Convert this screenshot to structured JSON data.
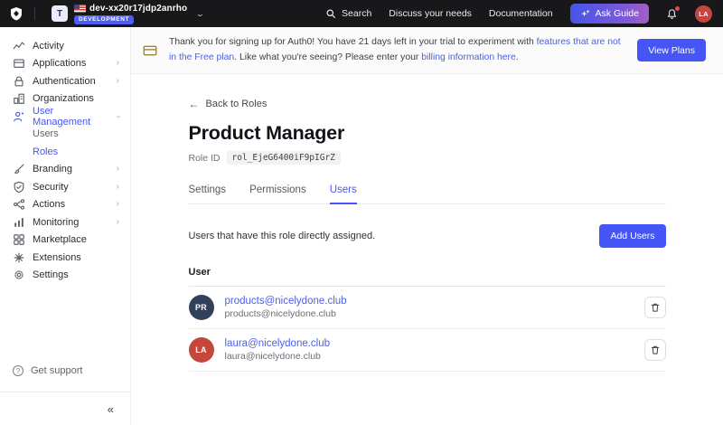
{
  "topbar": {
    "logo_icon": "auth0-shield-icon",
    "tenant": {
      "initial": "T",
      "flag_icon": "us-flag-icon",
      "name": "dev-xx20r17jdp2anrho",
      "env_badge": "DEVELOPMENT"
    },
    "search_label": "Search",
    "links": [
      "Discuss your needs",
      "Documentation"
    ],
    "ask_guide_label": "Ask Guide",
    "bell_icon": "bell-icon",
    "avatar_initials": "LA"
  },
  "banner": {
    "icon": "credit-card-icon",
    "text_before_link1": "Thank you for signing up for Auth0! You have 21 days left in your trial to experiment with ",
    "link1": "features that are not in the Free plan",
    "text_between": ". Like what you're seeing? Please enter your ",
    "link2": "billing information here",
    "text_after": ".",
    "view_plans_button": "View Plans"
  },
  "sidebar": {
    "items": [
      {
        "label": "Activity",
        "icon": "activity-icon",
        "chevron": "none"
      },
      {
        "label": "Applications",
        "icon": "applications-icon",
        "chevron": "right"
      },
      {
        "label": "Authentication",
        "icon": "authentication-icon",
        "chevron": "right"
      },
      {
        "label": "Organizations",
        "icon": "organizations-icon",
        "chevron": "none"
      },
      {
        "label": "User Management",
        "icon": "user-management-icon",
        "chevron": "down",
        "active": true,
        "children": [
          {
            "label": "Users",
            "active": false
          },
          {
            "label": "Roles",
            "active": true
          }
        ]
      },
      {
        "label": "Branding",
        "icon": "branding-icon",
        "chevron": "right"
      },
      {
        "label": "Security",
        "icon": "security-icon",
        "chevron": "right"
      },
      {
        "label": "Actions",
        "icon": "actions-icon",
        "chevron": "right"
      },
      {
        "label": "Monitoring",
        "icon": "monitoring-icon",
        "chevron": "right"
      },
      {
        "label": "Marketplace",
        "icon": "marketplace-icon",
        "chevron": "none"
      },
      {
        "label": "Extensions",
        "icon": "extensions-icon",
        "chevron": "none"
      },
      {
        "label": "Settings",
        "icon": "settings-icon",
        "chevron": "none"
      }
    ],
    "get_support": "Get support"
  },
  "main": {
    "back_link": "Back to Roles",
    "title": "Product Manager",
    "role_id_label": "Role ID",
    "role_id_value": "rol_EjeG6400iF9pIGrZ",
    "tabs": [
      {
        "label": "Settings",
        "active": false
      },
      {
        "label": "Permissions",
        "active": false
      },
      {
        "label": "Users",
        "active": true
      }
    ],
    "description": "Users that have this role directly assigned.",
    "add_users_button": "Add Users",
    "table": {
      "header": "User",
      "rows": [
        {
          "initials": "PR",
          "avatar_color": "#32405a",
          "email_link": "products@nicelydone.club",
          "email_sub": "products@nicelydone.club"
        },
        {
          "initials": "LA",
          "avatar_color": "#c4473a",
          "email_link": "laura@nicelydone.club",
          "email_sub": "laura@nicelydone.club"
        }
      ]
    }
  },
  "colors": {
    "topbar_bg": "#18181a",
    "accent_indigo": "#4655f5",
    "link_blue": "#4a5fe8",
    "env_badge_blue": "#4c5ef5",
    "banner_icon_gold": "#9a8530",
    "avatar_red": "#c4473f",
    "avatar_navy": "#32405a",
    "notification_dot": "#e5484d"
  }
}
